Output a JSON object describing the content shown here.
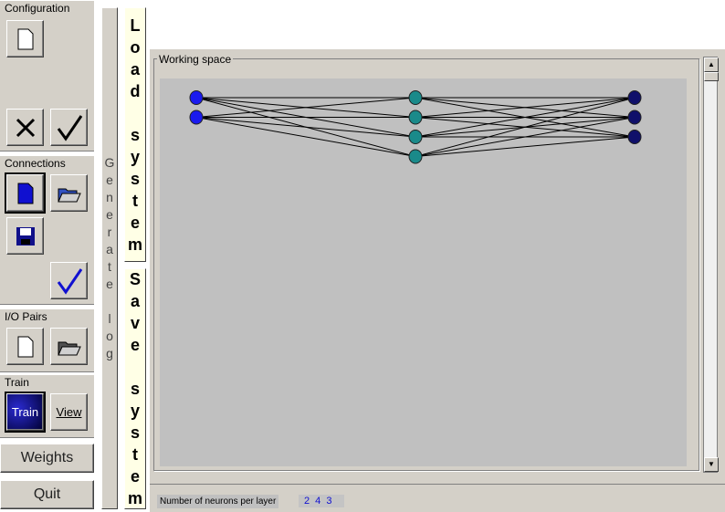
{
  "configuration": {
    "label": "Configuration",
    "icons": [
      "new-file-icon",
      "cancel-x-icon",
      "check-icon"
    ]
  },
  "connections": {
    "label": "Connections",
    "icons": [
      "new-blue-file-icon",
      "open-folder-icon",
      "save-disk-icon",
      "blue-check-icon"
    ]
  },
  "io_pairs": {
    "label": "I/O Pairs",
    "icons": [
      "new-file-icon",
      "open-folder-icon"
    ]
  },
  "train": {
    "label": "Train",
    "train_button": "Train",
    "view_button": "View"
  },
  "weights_button": "Weights",
  "quit_button": "Quit",
  "generate_log_button": "Generate log",
  "load_system_button": "Load system",
  "save_system_button": "Save system",
  "working_space": {
    "label": "Working space"
  },
  "network": {
    "layers": [
      2,
      4,
      3
    ],
    "layer_colors": [
      "#1a1aee",
      "#1a8a8a",
      "#10106a"
    ],
    "edge_color": "#000000",
    "canvas_color": "#c0c0c0"
  },
  "status": {
    "label": "Number of neurons per layer",
    "value": "2 4 3"
  }
}
